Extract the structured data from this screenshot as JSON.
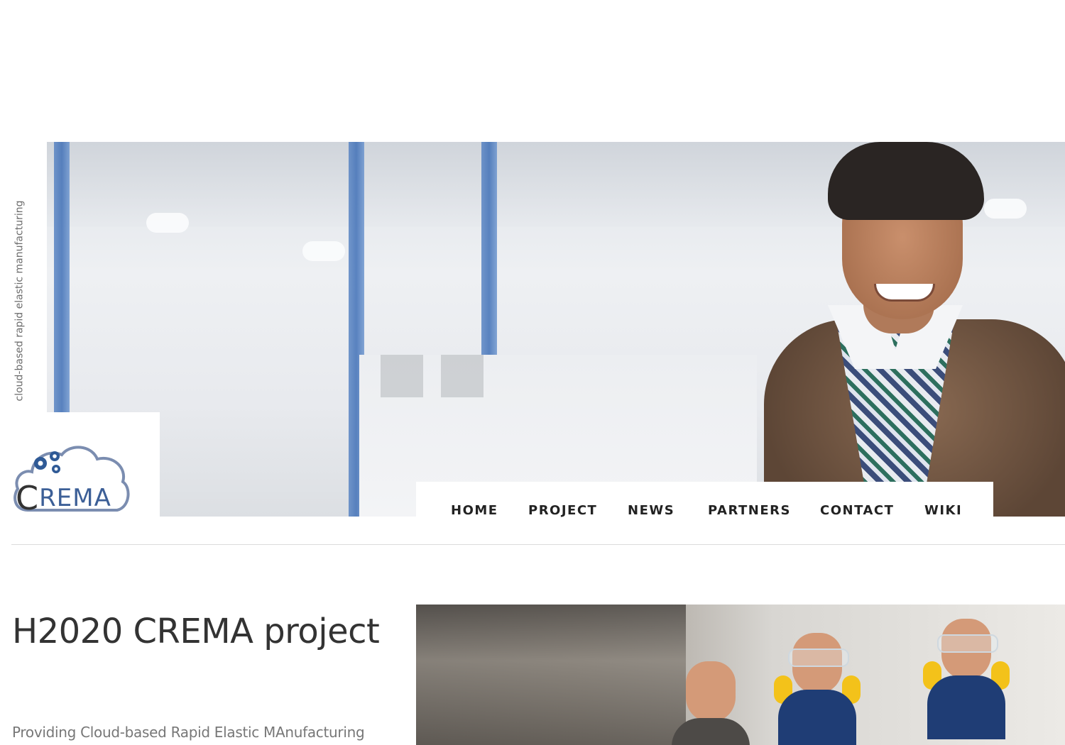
{
  "site": {
    "tagline_vertical": "cloud-based rapid elastic manufacturing",
    "logo_text_initial": "C",
    "logo_text_rest": "REMA"
  },
  "nav": {
    "items": [
      {
        "label": "HOME"
      },
      {
        "label": "PROJECT"
      },
      {
        "label": "NEWS"
      },
      {
        "label": "PARTNERS"
      },
      {
        "label": "CONTACT"
      },
      {
        "label": "WIKI"
      }
    ]
  },
  "main": {
    "title": "H2020 CREMA project",
    "subtitle": "Providing Cloud-based Rapid Elastic MAnufacturing"
  },
  "colors": {
    "brand_blue": "#3c5f97",
    "nav_text": "#222222",
    "heading": "#333333"
  },
  "icons": {
    "logo": "cloud-gears-icon"
  }
}
